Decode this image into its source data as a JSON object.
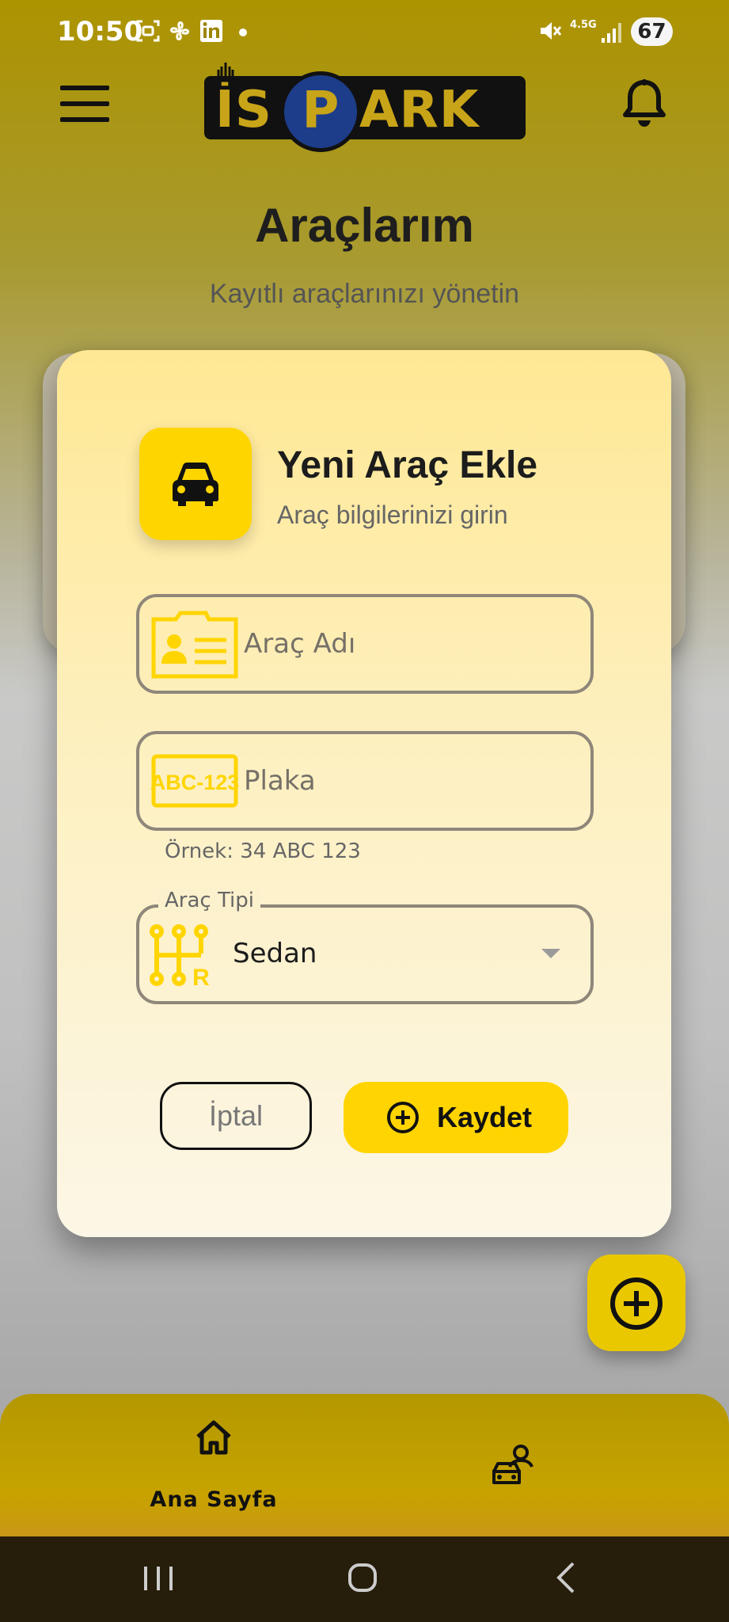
{
  "status_bar": {
    "time": "10:50",
    "network": "4.5G",
    "battery": "67"
  },
  "header": {
    "logo_text_left": "İS",
    "logo_text_p": "P",
    "logo_text_right": "ARK"
  },
  "page": {
    "title": "Araçlarım",
    "subtitle": "Kayıtlı araçlarınızı yönetin"
  },
  "dialog": {
    "title": "Yeni Araç Ekle",
    "subtitle": "Araç bilgilerinizi girin",
    "vehicle_name": {
      "placeholder": "Araç Adı",
      "value": ""
    },
    "plate": {
      "placeholder": "Plaka",
      "value": "",
      "hint": "Örnek: 34 ABC 123",
      "icon_text": "ABC-123"
    },
    "vehicle_type": {
      "label": "Araç Tipi",
      "selected": "Sedan"
    },
    "cancel_label": "İptal",
    "save_label": "Kaydet"
  },
  "bottom_nav": {
    "home_label": "Ana Sayfa"
  },
  "colors": {
    "accent": "#FFD500",
    "dark": "#111111"
  }
}
